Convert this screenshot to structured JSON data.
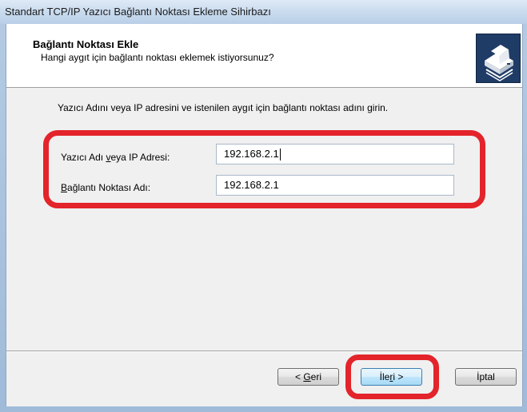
{
  "window": {
    "title": "Standart TCP/IP Yazıcı Bağlantı Noktası Ekleme Sihirbazı"
  },
  "header": {
    "title": "Bağlantı Noktası Ekle",
    "subtitle": "Hangi aygıt için bağlantı noktası eklemek istiyorsunuz?",
    "icon": "printer-icon"
  },
  "instructions": "Yazıcı Adını veya IP adresini ve istenilen aygıt için bağlantı noktası adını girin.",
  "fields": {
    "printer_name": {
      "label_pre": "Yazıcı Adı ",
      "label_accel": "v",
      "label_post": "eya IP Adresi:",
      "value": "192.168.2.1"
    },
    "port_name": {
      "label_pre": "",
      "label_accel": "B",
      "label_post": "ağlantı Noktası Adı:",
      "value": "192.168.2.1"
    }
  },
  "buttons": {
    "back": {
      "pre": "< ",
      "accel": "G",
      "post": "eri"
    },
    "next": {
      "pre": "İle",
      "accel": "r",
      "post": "i >"
    },
    "cancel": {
      "label": "İptal"
    }
  },
  "colors": {
    "highlight": "#e3242b",
    "header_bg": "#ffffff",
    "client_bg": "#f0f0f0",
    "frame": "#b5cbe3"
  }
}
